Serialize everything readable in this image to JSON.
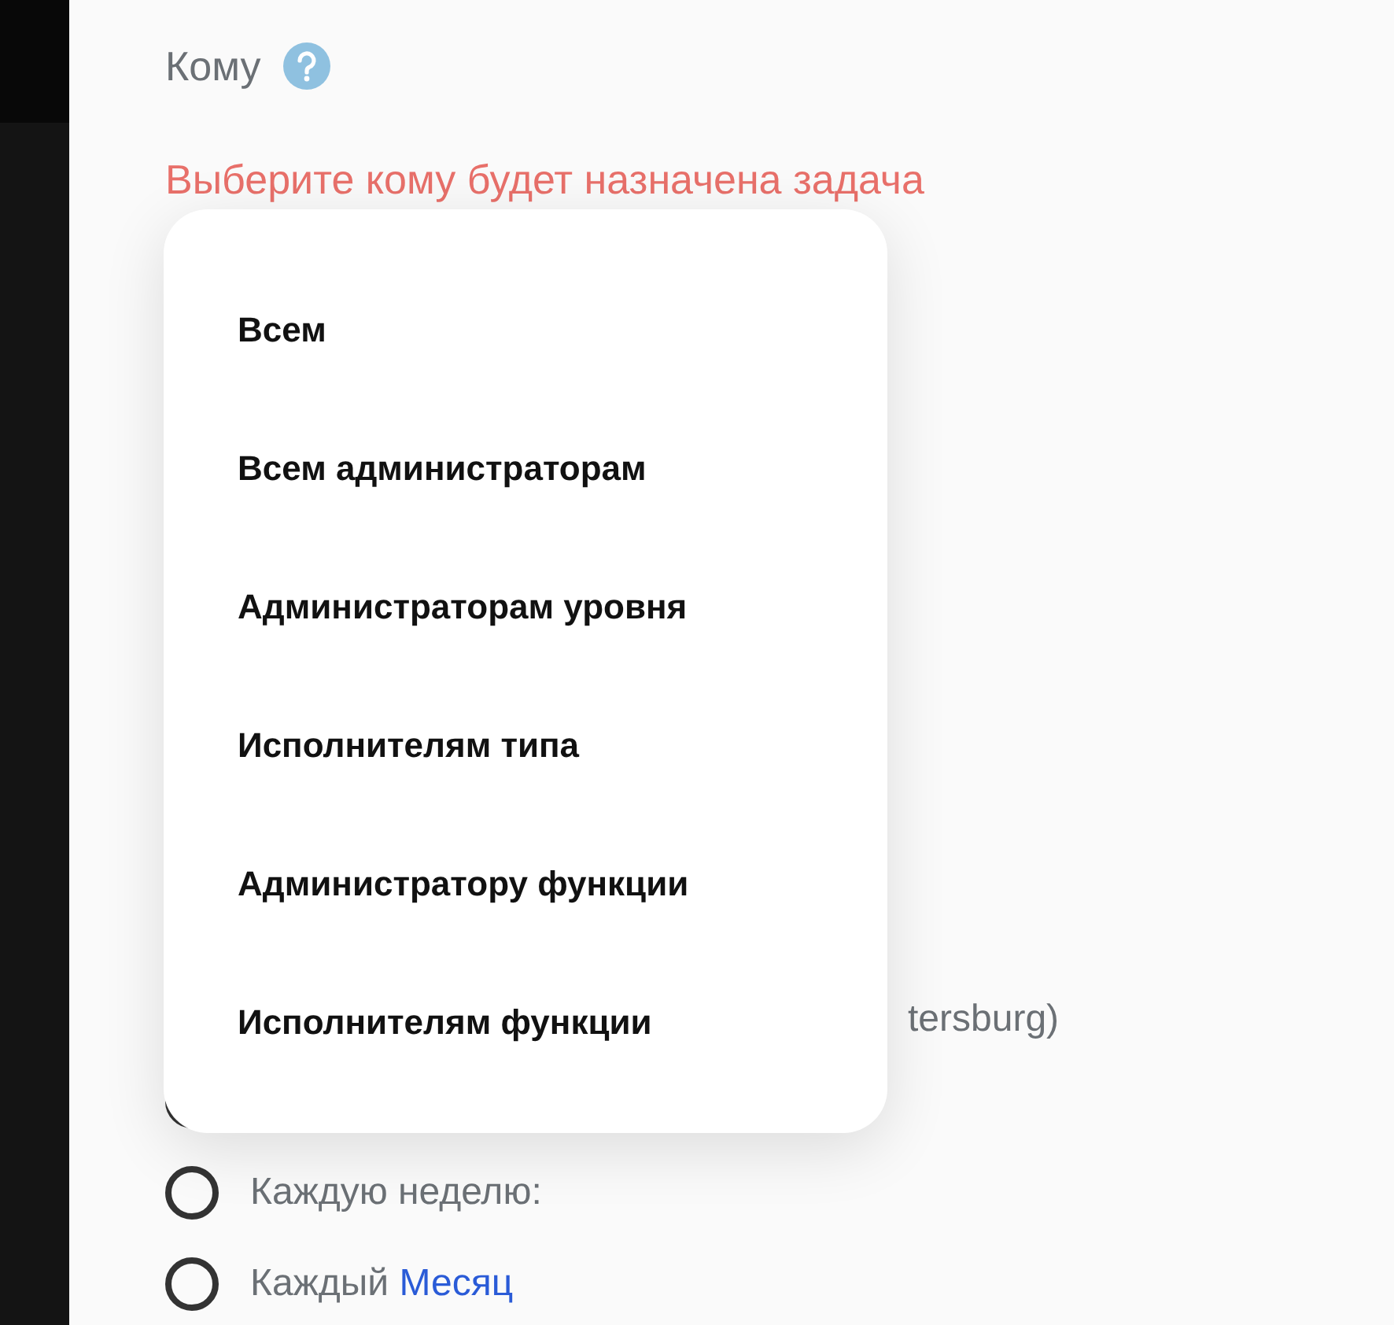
{
  "field": {
    "label": "Кому",
    "error": "Выберите кому будет назначена задача"
  },
  "dropdown": {
    "options": [
      {
        "label": "Всем"
      },
      {
        "label": "Всем администраторам"
      },
      {
        "label": "Администраторам уровня"
      },
      {
        "label": "Исполнителям типа"
      },
      {
        "label": "Администратору функции"
      },
      {
        "label": "Исполнителям функции"
      }
    ]
  },
  "timezone_fragment": "tersburg)",
  "repeat": [
    {
      "label": "Каждую неделю:",
      "selected": false
    },
    {
      "label": "Каждый",
      "link": "Месяц",
      "selected": false
    }
  ]
}
